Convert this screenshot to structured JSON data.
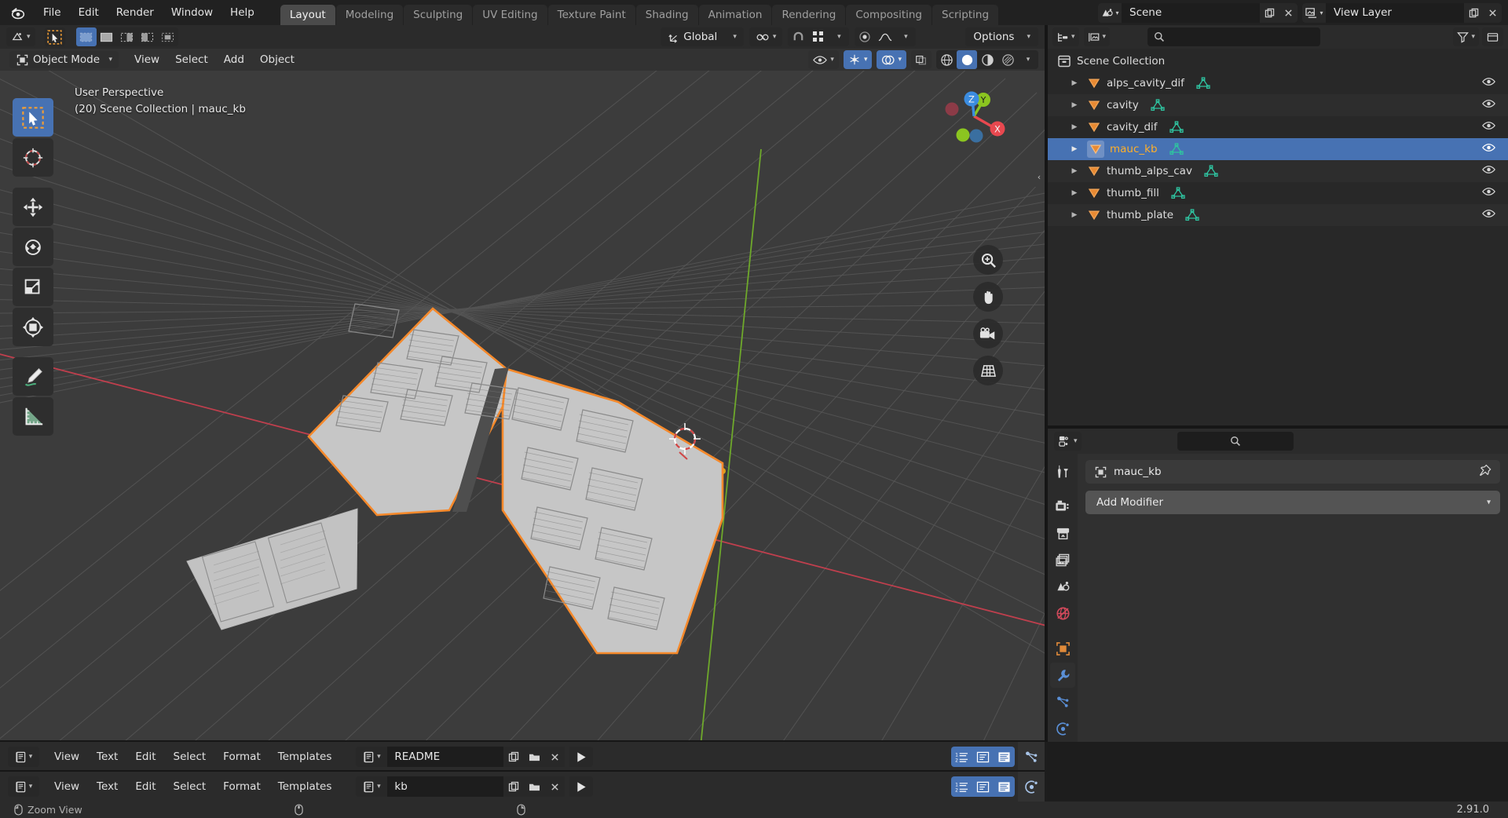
{
  "app": {
    "name": "Blender",
    "version": "2.91.0",
    "logo_icon": "blender-logo-icon"
  },
  "topbar": {
    "menus": [
      "File",
      "Edit",
      "Render",
      "Window",
      "Help"
    ],
    "workspace_tabs": [
      {
        "label": "Layout",
        "active": true
      },
      {
        "label": "Modeling",
        "active": false
      },
      {
        "label": "Sculpting",
        "active": false
      },
      {
        "label": "UV Editing",
        "active": false
      },
      {
        "label": "Texture Paint",
        "active": false
      },
      {
        "label": "Shading",
        "active": false
      },
      {
        "label": "Animation",
        "active": false
      },
      {
        "label": "Rendering",
        "active": false
      },
      {
        "label": "Compositing",
        "active": false
      },
      {
        "label": "Scripting",
        "active": false
      }
    ],
    "scene_name": "Scene",
    "view_layer_name": "View Layer",
    "scene_icon": "scene-icon",
    "view_layer_icon": "view-layer-icon",
    "new_icon": "new-datablock-icon",
    "unlink_icon": "unlink-icon"
  },
  "viewport_header": {
    "editor_type_icon": "editor-type-icon",
    "select_tool_icon": "tweak-select-icon",
    "select_modes": [
      "set-select",
      "extend-select",
      "subtract-select",
      "invert-select",
      "intersect-select"
    ],
    "transform_orientation": "Global",
    "snap_icon": "snapping-magnet-icon",
    "snap_target_icon": "snap-increment-icon",
    "proportional_icon": "proportional-edit-icon",
    "falloff_icon": "proportional-falloff-icon",
    "options_label": "Options"
  },
  "mode_header": {
    "mode": "Object Mode",
    "mode_icon": "object-mode-icon",
    "menus": [
      "View",
      "Select",
      "Add",
      "Object"
    ],
    "right_icons": [
      "visibility-eye-icon",
      "gizmo-icon",
      "overlays-icon",
      "xray-toggle-icon",
      "shading-wireframe-icon",
      "shading-solid-icon",
      "shading-material-icon",
      "shading-rendered-icon"
    ]
  },
  "viewport": {
    "perspective_label": "User Perspective",
    "scene_info": "(20) Scene Collection | mauc_kb",
    "tools": [
      {
        "name": "tweak-tool",
        "icon": "cursor-arrow-icon",
        "active": true
      },
      {
        "name": "cursor-tool",
        "icon": "3d-cursor-icon",
        "active": false
      },
      {
        "name": "move-tool",
        "icon": "move-arrows-icon",
        "active": false
      },
      {
        "name": "rotate-tool",
        "icon": "rotate-icon",
        "active": false
      },
      {
        "name": "scale-tool",
        "icon": "scale-icon",
        "active": false
      },
      {
        "name": "transform-tool",
        "icon": "transform-icon",
        "active": false
      },
      {
        "name": "annotate-tool",
        "icon": "pencil-annotate-icon",
        "active": false
      },
      {
        "name": "measure-tool",
        "icon": "ruler-measure-icon",
        "active": false
      }
    ],
    "gizmo_axes": [
      {
        "label": "X",
        "color": "#e8484f"
      },
      {
        "label": "Y",
        "color": "#8bc520"
      },
      {
        "label": "Z",
        "color": "#3b8ce0"
      }
    ],
    "nav_buttons": [
      "zoom-icon",
      "pan-hand-icon",
      "camera-view-icon",
      "orthographic-toggle-icon"
    ],
    "sidebar_toggle_icon": "chevron-left-icon",
    "colors": {
      "background": "#3c3c3c",
      "grid": "#575757",
      "x_axis": "#bf3f4d",
      "y_axis": "#6ea82b",
      "selection_outline": "#f5892b",
      "object_fill": "#c0c0c0"
    }
  },
  "outliner": {
    "display_mode_icon": "outliner-display-mode-icon",
    "filter_id_icon": "filter-id-icon",
    "search_placeholder": "",
    "search_icon": "search-icon",
    "filter_icon": "funnel-filter-icon",
    "new_collection_icon": "new-collection-icon",
    "root": {
      "label": "Scene Collection",
      "icon": "collection-box-icon"
    },
    "items": [
      {
        "label": "alps_cavity_dif",
        "icon": "mesh-object-icon",
        "data_icon": "mesh-data-icon",
        "selected": false,
        "visible": true
      },
      {
        "label": "cavity",
        "icon": "mesh-object-icon",
        "data_icon": "mesh-data-icon",
        "selected": false,
        "visible": true
      },
      {
        "label": "cavity_dif",
        "icon": "mesh-object-icon",
        "data_icon": "mesh-data-icon",
        "selected": false,
        "visible": true
      },
      {
        "label": "mauc_kb",
        "icon": "mesh-object-icon",
        "data_icon": "mesh-data-icon",
        "selected": true,
        "visible": true
      },
      {
        "label": "thumb_alps_cav",
        "icon": "mesh-object-icon",
        "data_icon": "mesh-data-icon",
        "selected": false,
        "visible": true
      },
      {
        "label": "thumb_fill",
        "icon": "mesh-object-icon",
        "data_icon": "mesh-data-icon",
        "selected": false,
        "visible": true
      },
      {
        "label": "thumb_plate",
        "icon": "mesh-object-icon",
        "data_icon": "mesh-data-icon",
        "selected": false,
        "visible": true
      }
    ]
  },
  "properties": {
    "editor_icon": "properties-editor-icon",
    "search_icon": "search-icon",
    "breadcrumb_object": "mauc_kb",
    "breadcrumb_icon": "object-icon",
    "pin_icon": "pin-icon",
    "add_modifier_label": "Add Modifier",
    "chevron_icon": "chevron-down-icon",
    "tabs": [
      {
        "name": "tool",
        "icon": "tool-screwdriver-wrench-icon",
        "active": false
      },
      {
        "name": "render",
        "icon": "render-camera-icon",
        "active": false
      },
      {
        "name": "output",
        "icon": "output-printer-icon",
        "active": false
      },
      {
        "name": "view-layer",
        "icon": "view-layer-images-icon",
        "active": false
      },
      {
        "name": "scene",
        "icon": "scene-cone-icon",
        "active": false
      },
      {
        "name": "world",
        "icon": "world-globe-icon",
        "active": false
      },
      {
        "name": "object",
        "icon": "object-square-icon",
        "active": false
      },
      {
        "name": "modifiers",
        "icon": "wrench-icon",
        "active": true
      },
      {
        "name": "particles",
        "icon": "particles-icon",
        "active": false
      },
      {
        "name": "physics",
        "icon": "physics-orbit-icon",
        "active": false
      }
    ]
  },
  "text_editors": [
    {
      "editor_icon": "text-editor-icon",
      "menus": [
        "View",
        "Text",
        "Edit",
        "Select",
        "Format",
        "Templates"
      ],
      "datablock_icon": "text-datablock-icon",
      "filename": "README",
      "new_icon": "new-text-icon",
      "open_icon": "open-folder-icon",
      "unlink_icon": "unlink-x-icon",
      "run_icon": "run-script-play-icon",
      "toggles": [
        "line-numbers-icon",
        "word-wrap-icon",
        "syntax-highlight-icon"
      ],
      "side_icon": "particles-icon"
    },
    {
      "editor_icon": "text-editor-icon",
      "menus": [
        "View",
        "Text",
        "Edit",
        "Select",
        "Format",
        "Templates"
      ],
      "datablock_icon": "text-datablock-icon",
      "filename": "kb",
      "new_icon": "new-text-icon",
      "open_icon": "open-folder-icon",
      "unlink_icon": "unlink-x-icon",
      "run_icon": "run-script-play-icon",
      "toggles": [
        "line-numbers-icon",
        "word-wrap-icon",
        "syntax-highlight-icon"
      ],
      "side_icon": "physics-orbit-icon"
    }
  ],
  "statusbar": {
    "mouse_icon_1": "mouse-left-icon",
    "hint_1": "Zoom View",
    "mouse_icon_2": "mouse-middle-icon",
    "mouse_icon_3": "mouse-right-icon",
    "version": "2.91.0"
  }
}
